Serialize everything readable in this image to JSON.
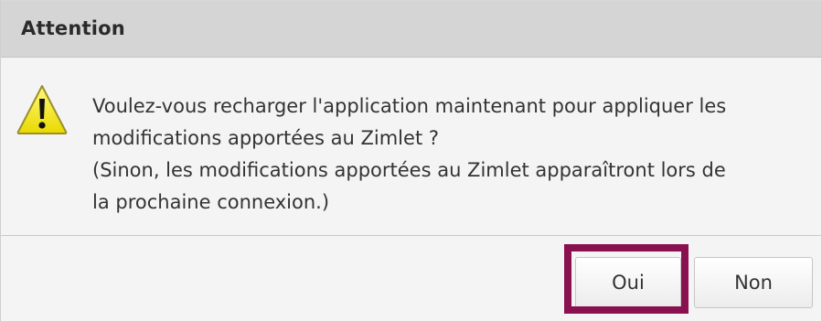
{
  "dialog": {
    "title": "Attention",
    "icon": "warning-icon",
    "message_lines": [
      "Voulez-vous recharger l'application maintenant pour appliquer les",
      "modifications apportées au Zimlet ?",
      "(Sinon, les modifications apportées au Zimlet apparaîtront lors de",
      "la prochaine connexion.)"
    ],
    "buttons": {
      "yes_label": "Oui",
      "no_label": "Non"
    },
    "colors": {
      "highlight": "#8a1150",
      "warning_fill": "#f2e800"
    }
  }
}
